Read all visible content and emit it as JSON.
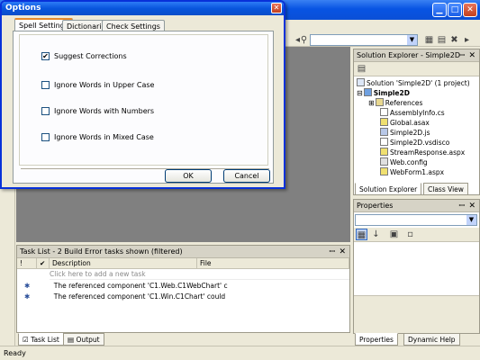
{
  "dialog": {
    "title": "Options",
    "close_glyph": "✕",
    "tabs": [
      {
        "label": "Spell Settings"
      },
      {
        "label": "Dictionaries"
      },
      {
        "label": "Check Settings"
      }
    ],
    "options": [
      {
        "label": "Suggest Corrections",
        "checked": true
      },
      {
        "label": "Ignore Words in Upper Case",
        "checked": false
      },
      {
        "label": "Ignore Words with Numbers",
        "checked": false
      },
      {
        "label": "Ignore Words in Mixed Case",
        "checked": false
      }
    ],
    "check_glyph": "✔",
    "ok_label": "OK",
    "cancel_label": "Cancel"
  },
  "solution_explorer": {
    "title": "Solution Explorer - Simple2D",
    "solution_label": "Solution 'Simple2D' (1 project)",
    "project_label": "Simple2D",
    "files": [
      "References",
      "AssemblyInfo.cs",
      "Global.asax",
      "Simple2D.js",
      "Simple2D.vsdisco",
      "StreamResponse.aspx",
      "Web.config",
      "WebForm1.aspx"
    ],
    "tabs": [
      "Solution Explorer",
      "Class View"
    ],
    "expand_glyph": "⊞",
    "collapse_glyph": "⊟"
  },
  "properties": {
    "title": "Properties",
    "tabs": [
      "Properties",
      "Dynamic Help"
    ]
  },
  "task_list": {
    "title": "Task List - 2 Build Error tasks shown (filtered)",
    "columns": {
      "mark": "!",
      "check": "✔",
      "description": "Description",
      "file": "File"
    },
    "add_placeholder": "Click here to add a new task",
    "rows": [
      {
        "description": "The referenced component 'C1.Web.C1WebChart' c"
      },
      {
        "description": "The referenced component 'C1.Win.C1Chart' could"
      }
    ],
    "tabs": [
      "Task List",
      "Output"
    ]
  },
  "panel_glyphs": {
    "pin": "ꟷ",
    "close": "✕"
  },
  "window_glyphs": {
    "minimize": "▁",
    "maximize": "□",
    "close": "✕"
  },
  "status": {
    "text": "Ready"
  },
  "colors": {
    "accent": "#0a4fd6",
    "workspace": "#808080",
    "chrome": "#ece9d8"
  }
}
